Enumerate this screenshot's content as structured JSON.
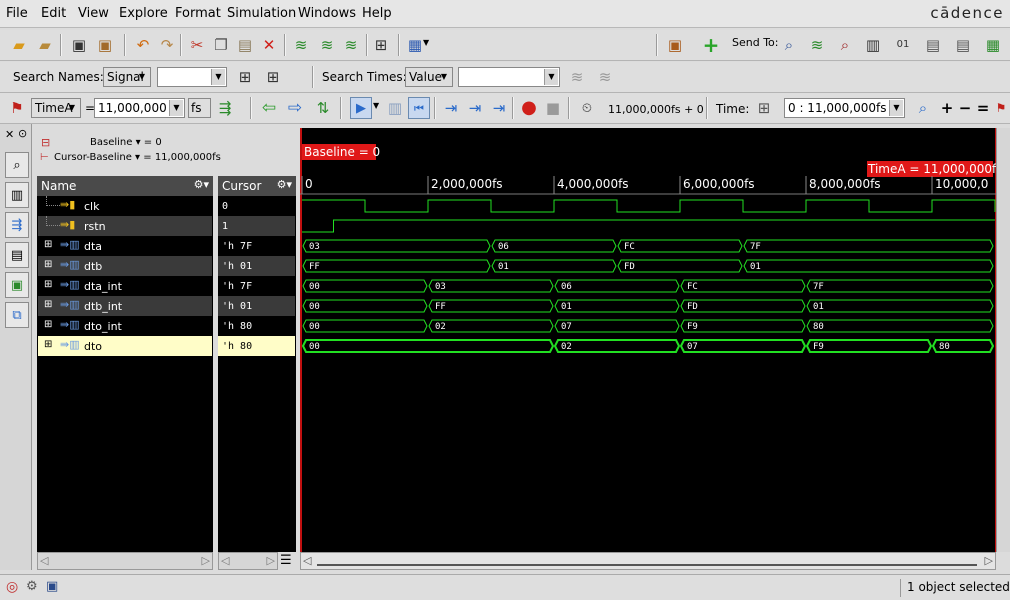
{
  "menubar": {
    "items": [
      "File",
      "Edit",
      "View",
      "Explore",
      "Format",
      "Simulation",
      "Windows",
      "Help"
    ],
    "brand": "cādence"
  },
  "toolbar1": {
    "send_to_label": "Send To:"
  },
  "search_bar": {
    "names_label": "Search Names:",
    "names_mode": "Signal",
    "names_value": "",
    "times_label": "Search Times:",
    "times_mode": "Value",
    "times_value": ""
  },
  "time_bar": {
    "marker": "TimeA",
    "equals": "=",
    "time_value": "11,000,000",
    "unit": "fs",
    "sim_time": "11,000,000fs + 0",
    "time_label": "Time:",
    "range": "0 : 11,000,000fs"
  },
  "info": {
    "baseline": "Baseline ▾ = 0",
    "cursor_baseline": "Cursor-Baseline ▾ = 11,000,000fs"
  },
  "columns": {
    "name": "Name",
    "cursor": "Cursor"
  },
  "waveform": {
    "baseline_marker": "Baseline = 0",
    "timea_marker": "TimeA = 11,000,000fs",
    "ticks": [
      "0",
      "2,000,000fs",
      "4,000,000fs",
      "6,000,000fs",
      "8,000,000fs",
      "10,000,0"
    ]
  },
  "signals": [
    {
      "name": "clk",
      "cursor": "0",
      "kind": "bit"
    },
    {
      "name": "rstn",
      "cursor": "1",
      "kind": "bit"
    },
    {
      "name": "dta",
      "cursor": "'h 7F",
      "kind": "bus",
      "segments": [
        {
          "t0": 0,
          "t1": 3,
          "v": "03"
        },
        {
          "t0": 3,
          "t1": 5,
          "v": "06"
        },
        {
          "t0": 5,
          "t1": 7,
          "v": "FC"
        },
        {
          "t0": 7,
          "t1": 11,
          "v": "7F"
        }
      ]
    },
    {
      "name": "dtb",
      "cursor": "'h 01",
      "kind": "bus",
      "segments": [
        {
          "t0": 0,
          "t1": 3,
          "v": "FF"
        },
        {
          "t0": 3,
          "t1": 5,
          "v": "01"
        },
        {
          "t0": 5,
          "t1": 7,
          "v": "FD"
        },
        {
          "t0": 7,
          "t1": 11,
          "v": "01"
        }
      ]
    },
    {
      "name": "dta_int",
      "cursor": "'h 7F",
      "kind": "bus",
      "segments": [
        {
          "t0": 0,
          "t1": 2,
          "v": "00"
        },
        {
          "t0": 2,
          "t1": 4,
          "v": "03"
        },
        {
          "t0": 4,
          "t1": 6,
          "v": "06"
        },
        {
          "t0": 6,
          "t1": 8,
          "v": "FC"
        },
        {
          "t0": 8,
          "t1": 11,
          "v": "7F"
        }
      ]
    },
    {
      "name": "dtb_int",
      "cursor": "'h 01",
      "kind": "bus",
      "segments": [
        {
          "t0": 0,
          "t1": 2,
          "v": "00"
        },
        {
          "t0": 2,
          "t1": 4,
          "v": "FF"
        },
        {
          "t0": 4,
          "t1": 6,
          "v": "01"
        },
        {
          "t0": 6,
          "t1": 8,
          "v": "FD"
        },
        {
          "t0": 8,
          "t1": 11,
          "v": "01"
        }
      ]
    },
    {
      "name": "dto_int",
      "cursor": "'h 80",
      "kind": "bus",
      "segments": [
        {
          "t0": 0,
          "t1": 2,
          "v": "00"
        },
        {
          "t0": 2,
          "t1": 4,
          "v": "02"
        },
        {
          "t0": 4,
          "t1": 6,
          "v": "07"
        },
        {
          "t0": 6,
          "t1": 8,
          "v": "F9"
        },
        {
          "t0": 8,
          "t1": 11,
          "v": "80"
        }
      ]
    },
    {
      "name": "dto",
      "cursor": "'h 80",
      "kind": "bus",
      "selected": true,
      "segments": [
        {
          "t0": 0,
          "t1": 4,
          "v": "00"
        },
        {
          "t0": 4,
          "t1": 6,
          "v": "02"
        },
        {
          "t0": 6,
          "t1": 8,
          "v": "07"
        },
        {
          "t0": 8,
          "t1": 10,
          "v": "F9"
        },
        {
          "t0": 10,
          "t1": 11,
          "v": "80"
        }
      ]
    }
  ],
  "status": {
    "text": "1 object selected"
  }
}
